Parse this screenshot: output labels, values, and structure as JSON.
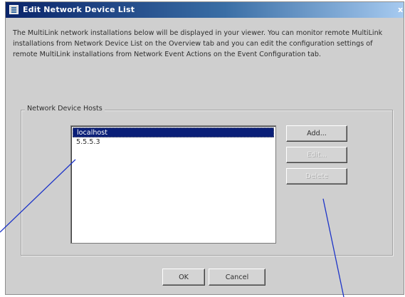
{
  "window": {
    "title": "Edit Network Device List",
    "close_glyph": "x"
  },
  "description": "The MultiLink network installations below will be displayed in your viewer. You can monitor remote MultiLink installations from Network Device List on the Overview tab and you can edit the configuration settings of remote MultiLink installations from Network Event Actions on the Event Configuration tab.",
  "hosts_group": {
    "legend": "Network Device Hosts",
    "hosts": [
      {
        "name": "localhost",
        "selected": true
      },
      {
        "name": "5.5.5.3",
        "selected": false
      }
    ]
  },
  "side_buttons": {
    "add": "Add...",
    "edit": "Edit...",
    "delete": "Delete"
  },
  "footer_buttons": {
    "ok": "OK",
    "cancel": "Cancel"
  },
  "colors": {
    "selection": "#0a1f78",
    "dialog_bg": "#cfcfcf",
    "annotation_line": "#1d34c8"
  }
}
